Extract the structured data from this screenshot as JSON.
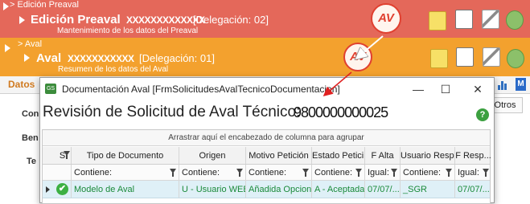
{
  "header_preaval": {
    "breadcrumb": "> Edición Preaval",
    "title": "Edición Preaval",
    "redacted_id": "XXXXXXXXXXXXX",
    "delegacion": "[Delegación: 02]",
    "subtitle": "Mantenimiento de los datos del Preaval",
    "logo_text": "AV"
  },
  "header_aval": {
    "breadcrumb": "> Aval",
    "title": "Aval",
    "redacted_id": "XXXXXXXXXXX",
    "delegacion": "[Delegación: 01]",
    "subtitle": "Resumen de los datos del Aval",
    "logo_text": "AV"
  },
  "background": {
    "tab_datos": "Datos",
    "tab_otros": "Otros",
    "labels": [
      "Con",
      "Ben",
      "Te"
    ]
  },
  "dialog": {
    "title": "Documentación Aval [FrmSolicitudesAvalTecnicoDocumentacion]",
    "app_icon": "GS",
    "minimize": "—",
    "maximize": "☐",
    "close": "✕",
    "heading": "Revisión de Solicitud de Aval Técnico:",
    "heading_number": "9800000000025",
    "grid": {
      "group_hint": "Arrastrar aquí el encabezado de columna para agrupar",
      "columns": [
        "S",
        "Tipo de Documento",
        "Origen",
        "Motivo Petición",
        "Estado Petici...",
        "F Alta",
        "Usuario Resp...",
        "F Resp..."
      ],
      "filters": [
        "",
        "Contiene:",
        "Contiene:",
        "Contiene:",
        "Contiene:",
        "Igual:",
        "Contiene:",
        "Igual:"
      ],
      "rows": [
        [
          "✔",
          "Modelo de Aval",
          "U - Usuario WEB",
          "Añadida Opcion...",
          "A - Aceptada",
          "07/07/...",
          "_SGR",
          "07/07/..."
        ]
      ]
    }
  },
  "colors": {
    "preaval_header": "#e4685a",
    "aval_header": "#f3a12e",
    "row_text": "#1a8a3a",
    "selected_row": "#dff0f7"
  }
}
